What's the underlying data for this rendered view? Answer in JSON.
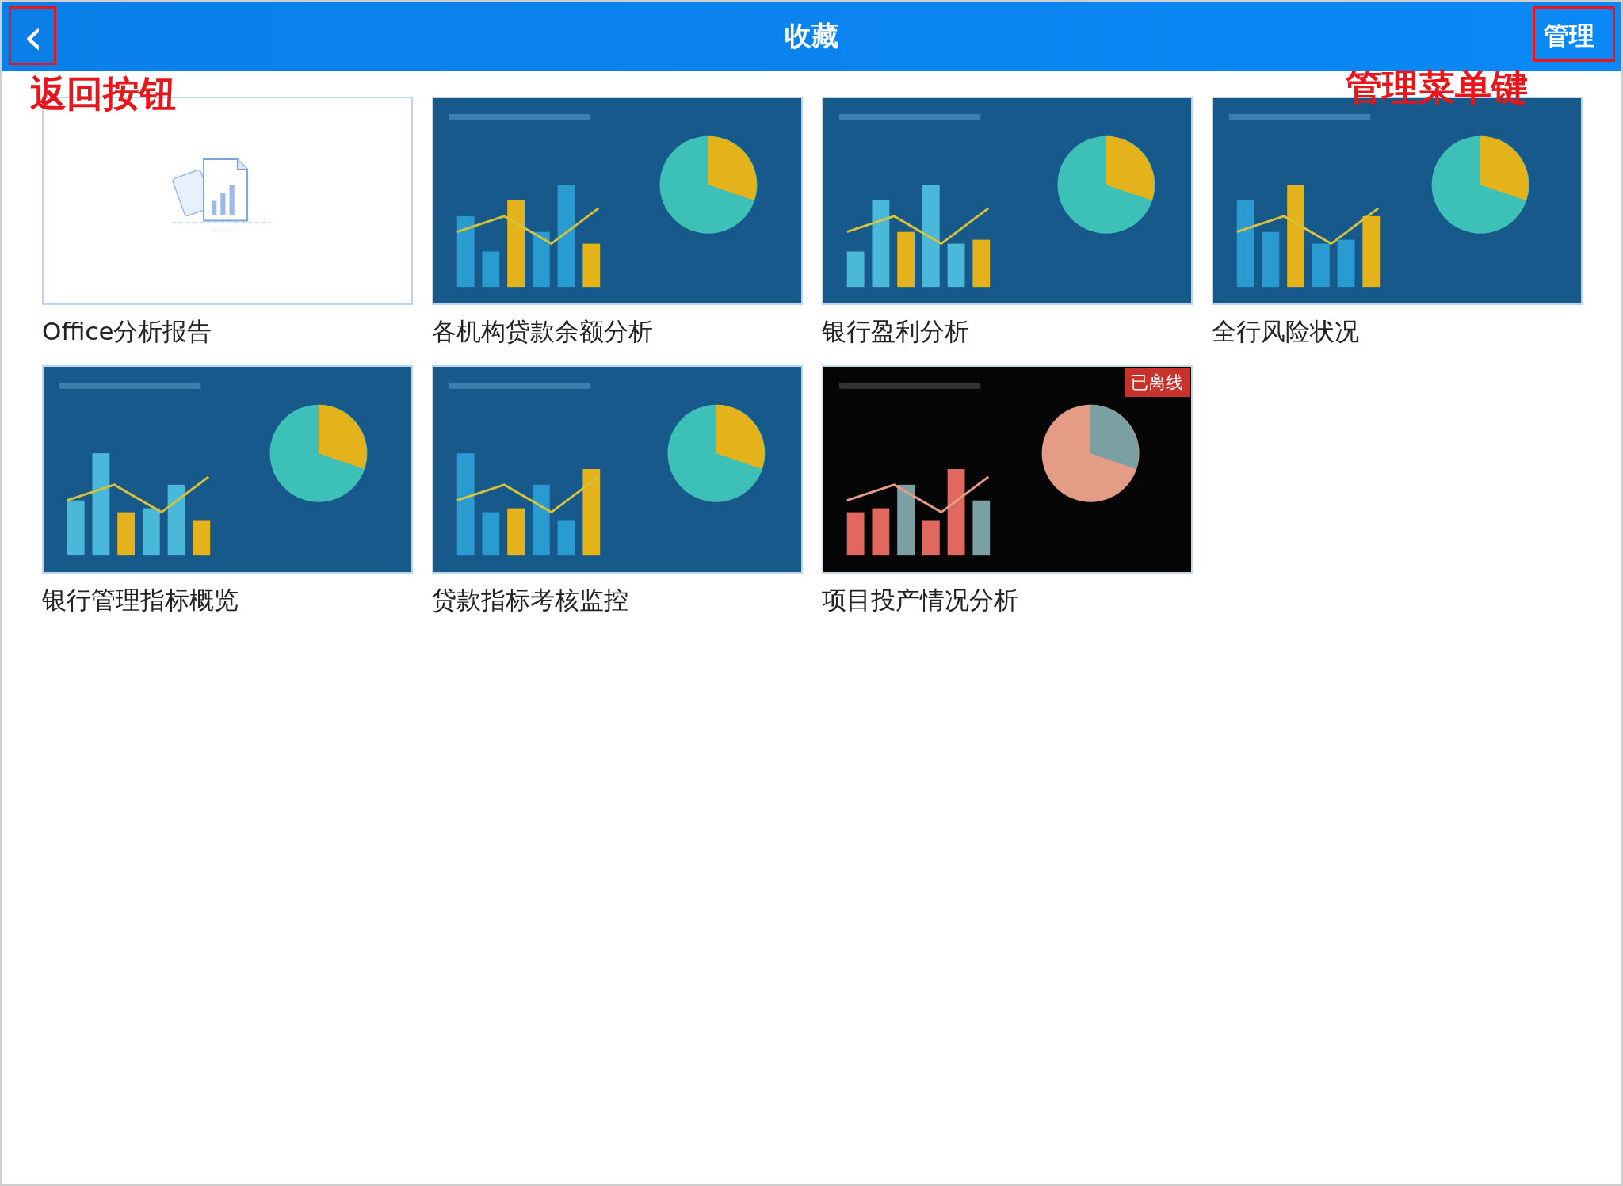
{
  "header": {
    "title": "收藏",
    "back_icon": "‹",
    "manage_button": "管理"
  },
  "annotations": [
    {
      "kind": "back",
      "label": "返回按钮"
    },
    {
      "kind": "manage",
      "label": "管理菜单键"
    }
  ],
  "reports": [
    {
      "title": "Office分析报告",
      "thumbnail": {
        "kind": "placeholder"
      },
      "offline": false
    },
    {
      "title": "各机构贷款余额分析",
      "offline": false
    },
    {
      "title": "银行盈利分析",
      "offline": false
    },
    {
      "title": "全行风险状况",
      "offline": false
    },
    {
      "title": "银行管理指标概览",
      "offline": false
    },
    {
      "title": "贷款指标考核监控",
      "offline": false
    },
    {
      "title": "项目投产情况分析",
      "offline": true,
      "badge": "已离线"
    }
  ]
}
